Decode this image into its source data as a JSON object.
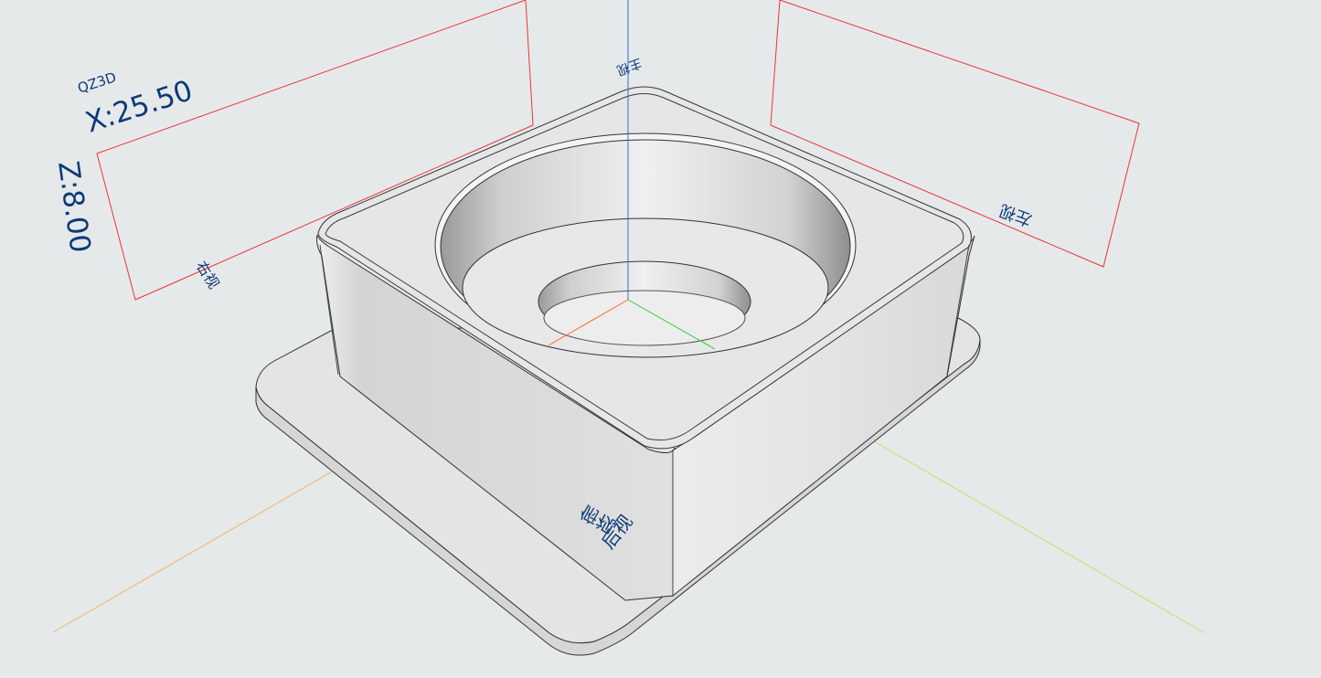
{
  "viewport": {
    "brand": "QZ3D",
    "x_readout": "X:25.50",
    "z_readout": "Z:8.00",
    "view_labels": {
      "top": "主视",
      "left": "左视",
      "right": "右视",
      "back": "后视",
      "bottom": "俯视"
    },
    "colors": {
      "background": "#e5e9ea",
      "model_fill": "#e2e2e2",
      "model_edge": "#333333",
      "label_text": "#0d3a78",
      "plane_outline": "#ee3333",
      "axis_z": "#2f6fe0",
      "axis_x": "#ff6a20",
      "axis_y": "#33cc33",
      "guide_orange": "#f2b55a",
      "guide_green": "#c8e060"
    }
  }
}
